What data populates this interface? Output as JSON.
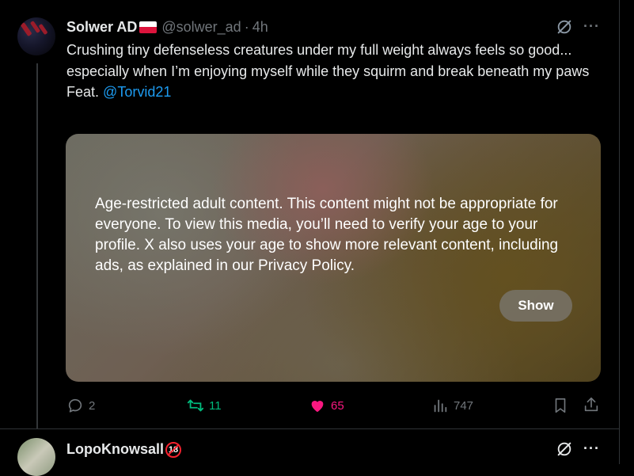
{
  "colors": {
    "accent": "#1d9bf0",
    "retweet": "#00ba7c",
    "like": "#f91880",
    "muted": "#71767b"
  },
  "post": {
    "author_name": "Solwer AD",
    "author_flag_icon": "poland-flag-icon",
    "handle": "@solwer_ad",
    "separator": "·",
    "time": "4h",
    "text_line1": "Crushing tiny defenseless creatures under my full weight always feels so good... especially when I’m enjoying myself while they squirm and break beneath my paws",
    "text_feat": "Feat.",
    "mention": "@Torvid21",
    "media_warning": "Age-restricted adult content. This content might not be appropriate for everyone. To view this media, you’ll need to verify your age to your profile. X also uses your age to show more relevant content, including ads, as explained in our Privacy Policy.",
    "show_label": "Show",
    "replies": "2",
    "reposts": "11",
    "likes": "65",
    "views": "747"
  },
  "next_post": {
    "author_name": "LopoKnowsall",
    "badge": "18"
  }
}
